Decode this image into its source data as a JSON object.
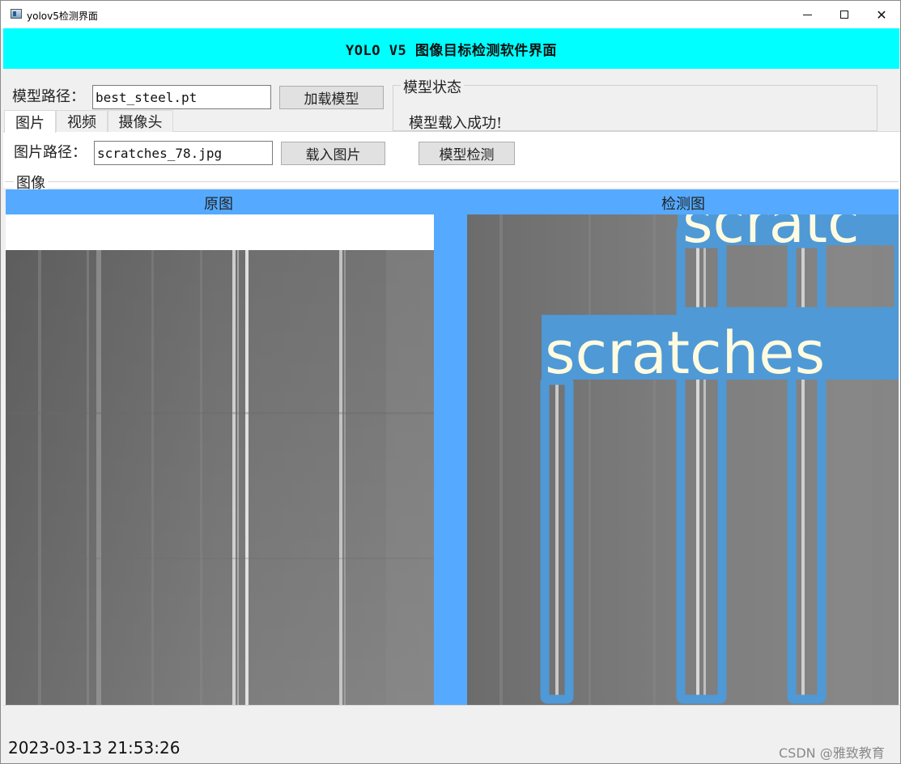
{
  "window": {
    "title": "yolov5检测界面"
  },
  "banner": {
    "title": "YOLO V5 图像目标检测软件界面"
  },
  "model": {
    "path_label": "模型路径：",
    "path_value": "best_steel.pt",
    "load_button": "加载模型",
    "status_group_title": "模型状态",
    "status_text": "模型载入成功!"
  },
  "tabs": [
    {
      "label": "图片",
      "active": true
    },
    {
      "label": "视频",
      "active": false
    },
    {
      "label": "摄像头",
      "active": false
    }
  ],
  "image_tab": {
    "path_label": "图片路径：",
    "path_value": "scratches_78.jpg",
    "load_button": "载入图片",
    "detect_button": "模型检测"
  },
  "image_group": {
    "title": "图像",
    "original_label": "原图",
    "detected_label": "检测图"
  },
  "detections": [
    {
      "label": "scratches"
    },
    {
      "label": "scratc"
    }
  ],
  "colors": {
    "accent_cyan": "#00ffff",
    "band_blue": "#55aaff",
    "box_blue": "#4f99d6",
    "label_text": "#fffbe0"
  },
  "status": {
    "datetime": "2023-03-13 21:53:26"
  },
  "watermark": "CSDN @雅致教育"
}
